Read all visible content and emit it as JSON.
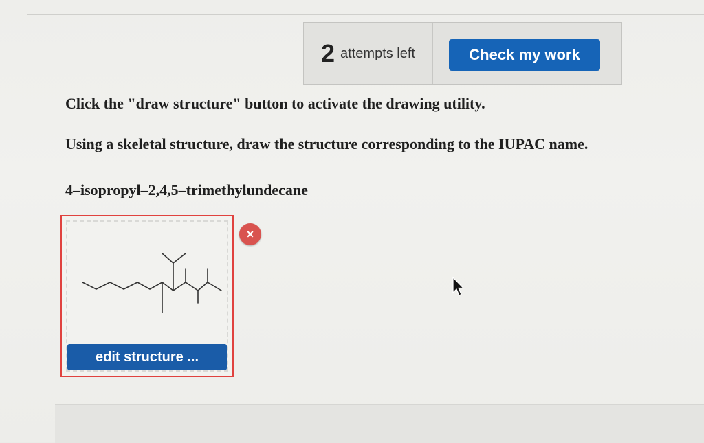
{
  "attempts": {
    "count": "2",
    "label": "attempts left"
  },
  "toolbar": {
    "check_label": "Check my work"
  },
  "instructions": {
    "line1": "Click the \"draw structure\" button to activate the drawing utility.",
    "line2": "Using a skeletal structure, draw the structure corresponding to the IUPAC name.",
    "iupac_name": "4–isopropyl–2,4,5–trimethylundecane"
  },
  "drawing": {
    "edit_label": "edit structure ...",
    "close_glyph": "×"
  },
  "colors": {
    "accent_blue": "#1664b7",
    "border_red": "#e0423f",
    "close_red": "#d9534f"
  },
  "icons": {
    "close": "close-icon",
    "cursor": "mouse-cursor-icon"
  }
}
